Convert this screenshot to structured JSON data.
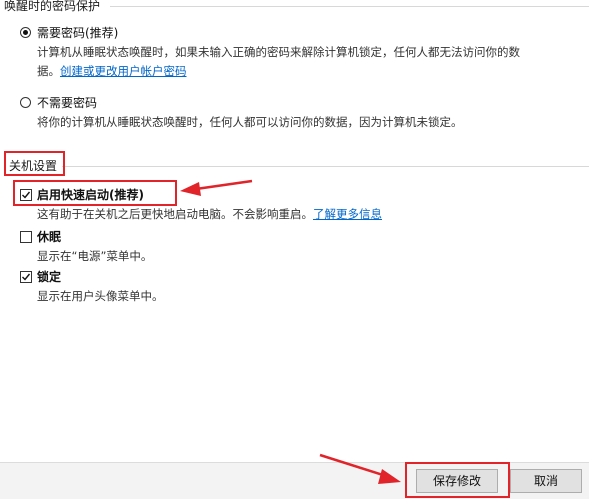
{
  "wake_password": {
    "title": "唤醒时的密码保护",
    "options": [
      {
        "label": "需要密码(推荐)",
        "checked": true,
        "desc_line1": "计算机从睡眠状态唤醒时，如果未输入正确的密码来解除计算机锁定，任何人都无法访问你的数",
        "desc_line2_prefix": "据。",
        "link": "创建或更改用户帐户密码"
      },
      {
        "label": "不需要密码",
        "checked": false,
        "desc_line1": "将你的计算机从睡眠状态唤醒时，任何人都可以访问你的数据，因为计算机未锁定。"
      }
    ]
  },
  "shutdown": {
    "title": "关机设置",
    "items": [
      {
        "label": "启用快速启动(推荐)",
        "checked": true,
        "desc": "这有助于在关机之后更快地启动电脑。不会影响重启。",
        "link": "了解更多信息"
      },
      {
        "label": "休眠",
        "checked": false,
        "desc": "显示在“电源”菜单中。"
      },
      {
        "label": "锁定",
        "checked": true,
        "desc": "显示在用户头像菜单中。"
      }
    ]
  },
  "footer": {
    "save_label": "保存修改",
    "cancel_label": "取消"
  },
  "annotation_color": "#e0242a"
}
